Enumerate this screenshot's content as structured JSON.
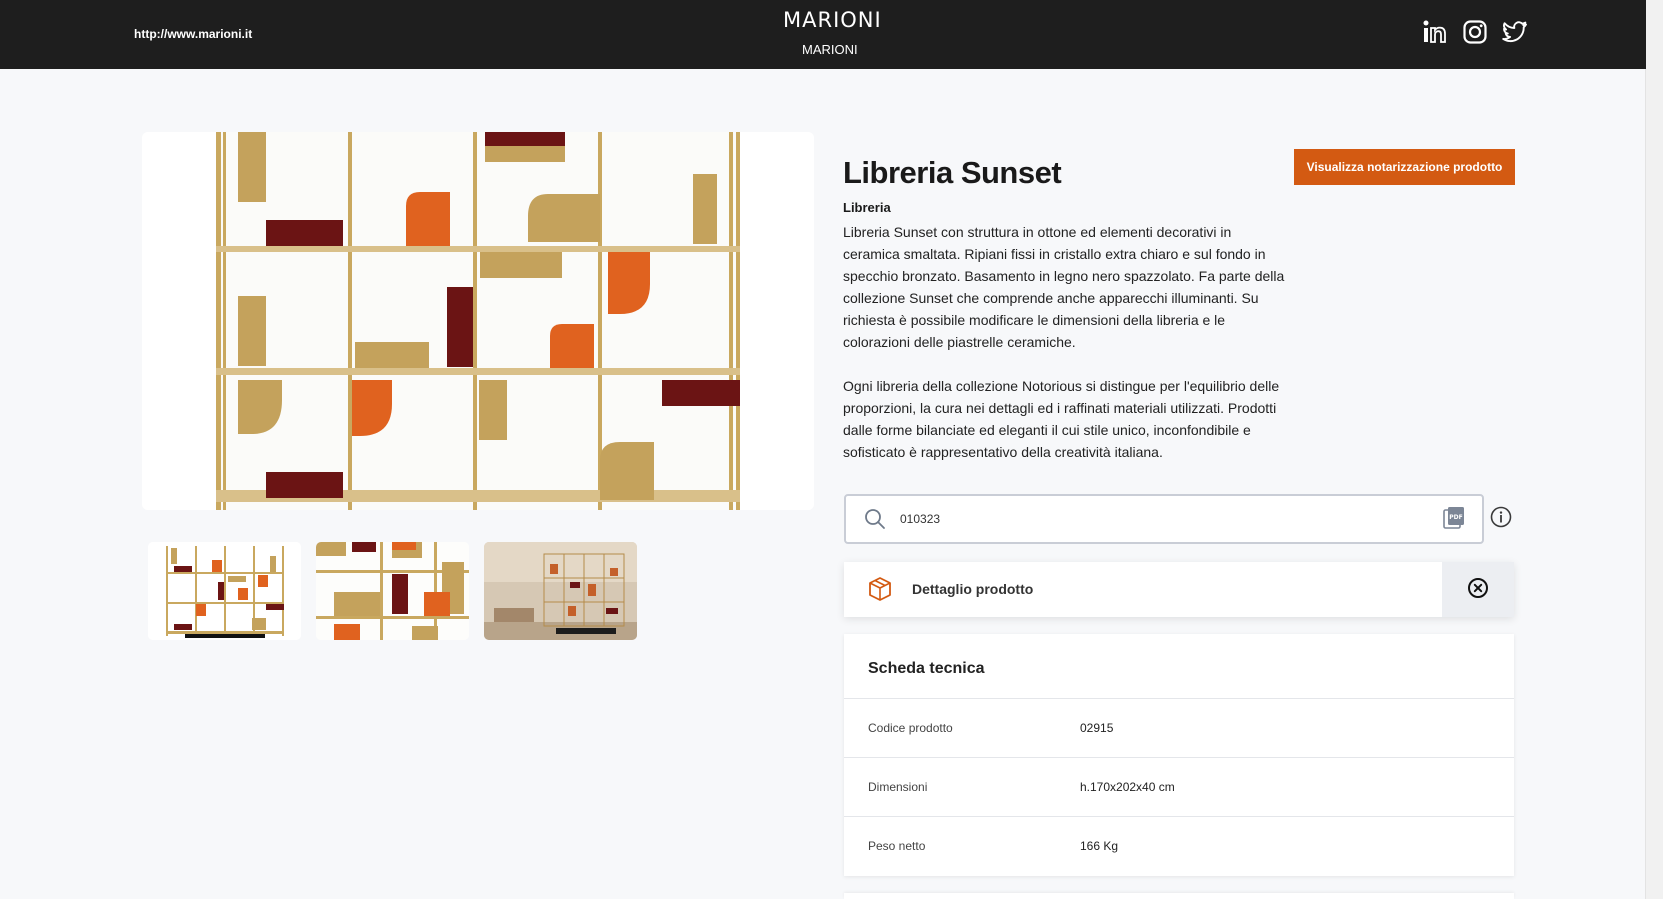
{
  "header": {
    "url": "http://www.marioni.it",
    "logo_text": "MARIONI",
    "brand_name": "MARIONI",
    "social_icons": [
      "linkedin-icon",
      "instagram-icon",
      "twitter-icon"
    ]
  },
  "gallery": {
    "thumbnails": [
      "product-front-view",
      "product-detail-view",
      "product-room-view"
    ],
    "active_thumbnail": 0
  },
  "product": {
    "title": "Libreria Sunset",
    "category": "Libreria",
    "description_1": "Libreria Sunset con struttura in ottone ed elementi decorativi in ceramica smaltata. Ripiani fissi in cristallo extra chiaro e sul fondo in specchio bronzato. Basamento in legno nero spazzolato. Fa parte della collezione Sunset che comprende anche apparecchi illuminanti. Su richiesta è possibile modificare le dimensioni della libreria e le colorazioni delle piastrelle ceramiche.",
    "description_2": "Ogni libreria della collezione Notorious si distingue per l'equilibrio delle proporzioni, la cura nei dettagli ed i raffinati materiali utilizzati. Prodotti dalle forme bilanciate ed eleganti il cui stile unico, inconfondibile e sofisticato è rappresentativo della creatività italiana.",
    "notarization_button": "Visualizza notarizzazione prodotto"
  },
  "search": {
    "value": "010323",
    "icons": [
      "search-icon",
      "pdf-icon",
      "info-icon"
    ]
  },
  "detail": {
    "label": "Dettaglio prodotto",
    "icons": [
      "box-icon",
      "close-icon"
    ]
  },
  "tech_sheet": {
    "title": "Scheda tecnica",
    "rows": [
      {
        "label": "Codice prodotto",
        "value": "02915"
      },
      {
        "label": "Dimensioni",
        "value": "h.170x202x40 cm"
      },
      {
        "label": "Peso netto",
        "value": "166 Kg"
      }
    ]
  },
  "colors": {
    "header_bg": "#1e1e1e",
    "accent": "#d35a12",
    "brass": "#c9a85f",
    "ceramic_orange": "#e0621f",
    "ceramic_burgundy": "#6b1414"
  }
}
